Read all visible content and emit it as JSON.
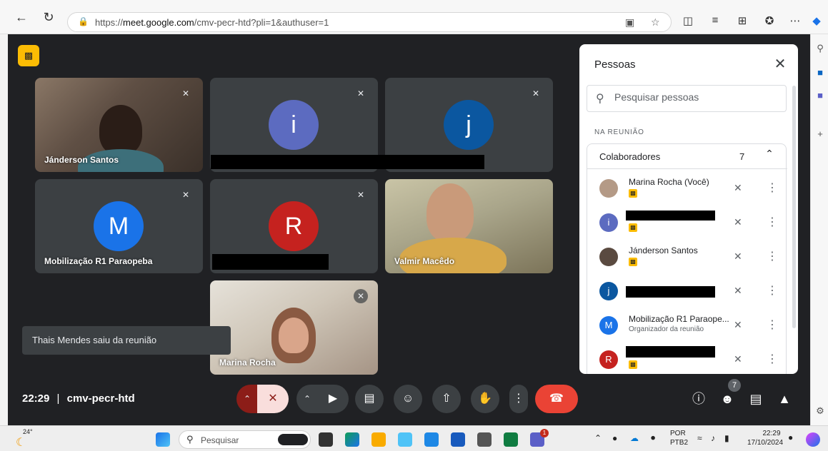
{
  "browser": {
    "url_prefix": "https://",
    "url_host": "meet.google.com",
    "url_path": "/cmv-pecr-htd?pli=1&authuser=1"
  },
  "tiles": [
    {
      "name": "Jánderson Santos"
    },
    {
      "avatar_letter": "i",
      "avatar_color": "#5c6bc0"
    },
    {
      "avatar_letter": "j",
      "avatar_color": "#0b57a0"
    },
    {
      "name": "Mobilização R1 Paraopeba",
      "avatar_letter": "M",
      "avatar_color": "#1a73e8"
    },
    {
      "avatar_letter": "R",
      "avatar_color": "#c5221f"
    },
    {
      "name": "Valmir Macêdo"
    },
    {
      "name": "Marina Rocha"
    }
  ],
  "toast": "Thais Mendes saiu da reunião",
  "bottom": {
    "time": "22:29",
    "separator": "|",
    "meeting_code": "cmv-pecr-htd",
    "people_count": "7"
  },
  "panel": {
    "title": "Pessoas",
    "search_placeholder": "Pesquisar pessoas",
    "section_label": "NA REUNIÃO",
    "group_name": "Colaboradores",
    "group_count": "7",
    "participants": [
      {
        "name": "Marina Rocha (Você)",
        "avatar_color": "#b49a86",
        "letter": ""
      },
      {
        "name": "",
        "avatar_color": "#5c6bc0",
        "letter": "i"
      },
      {
        "name": "Jánderson Santos",
        "avatar_color": "#5a4a40",
        "letter": ""
      },
      {
        "name": "",
        "avatar_color": "#0b57a0",
        "letter": "j"
      },
      {
        "name": "Mobilização R1 Paraope...",
        "sub": "Organizador da reunião",
        "avatar_color": "#1a73e8",
        "letter": "M"
      },
      {
        "name": "",
        "avatar_color": "#c5221f",
        "letter": "R"
      }
    ]
  },
  "taskbar": {
    "weather": "24°",
    "search_label": "Pesquisar",
    "lang_1": "POR",
    "lang_2": "PTB2",
    "time": "22:29",
    "date": "17/10/2024",
    "teams_badge": "1"
  },
  "colors": {
    "meet_bg": "#202124",
    "tile_bg": "#3c4043",
    "end_call": "#ea4335",
    "mic_muted": "#f9dedc",
    "host_badge": "#fbbc04"
  }
}
